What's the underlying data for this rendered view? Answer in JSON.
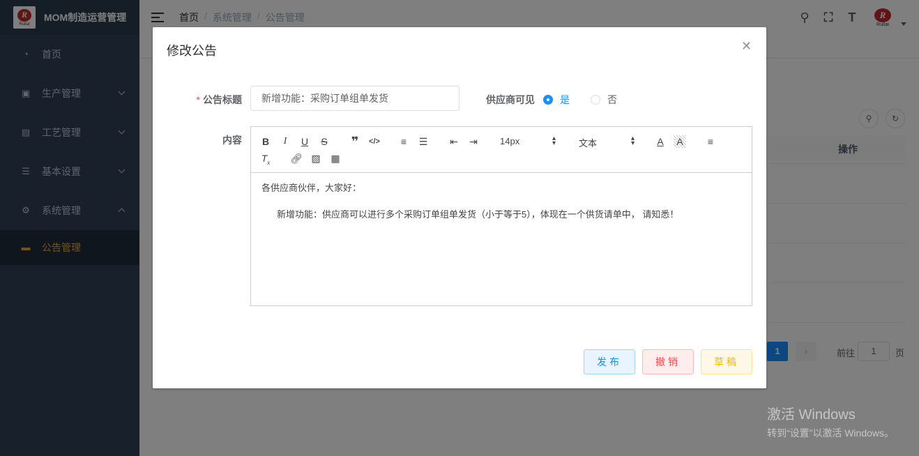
{
  "app": {
    "title": "MOM制造运营管理",
    "logo_text": "Ruitai"
  },
  "sidebar": {
    "items": [
      {
        "label": "首页",
        "icon": "dashboard-icon"
      },
      {
        "label": "生产管理",
        "icon": "production-icon"
      },
      {
        "label": "工艺管理",
        "icon": "process-icon"
      },
      {
        "label": "基本设置",
        "icon": "settings-sliders-icon"
      },
      {
        "label": "系统管理",
        "icon": "gear-icon"
      }
    ],
    "active_sub": {
      "label": "公告管理",
      "icon": "message-icon"
    }
  },
  "breadcrumb": [
    "首页",
    "系统管理",
    "公告管理"
  ],
  "table": {
    "ops_header": "操作"
  },
  "pagination": {
    "current": "1",
    "goto_prefix": "前往",
    "goto_value": "1",
    "goto_suffix": "页"
  },
  "dialog": {
    "title": "修改公告",
    "title_label": "公告标题",
    "title_value": "新增功能：采购订单组单发货",
    "visible_label": "供应商可见",
    "radio_yes": "是",
    "radio_no": "否",
    "content_label": "内容",
    "toolbar": {
      "font_size": "14px",
      "block_type": "文本"
    },
    "content_p1": "各供应商伙伴，大家好：",
    "content_p2": "新增功能：供应商可以进行多个采购订单组单发货（小于等于5），体现在一个供货请单中， 请知悉！",
    "buttons": {
      "publish": "发布",
      "revoke": "撤销",
      "draft": "草稿"
    }
  },
  "watermark": {
    "line1": "激活 Windows",
    "line2": "转到“设置”以激活 Windows。"
  },
  "colors": {
    "sidebar_bg": "#304156",
    "accent": "#1890ff",
    "active_menu": "#f5a623"
  }
}
